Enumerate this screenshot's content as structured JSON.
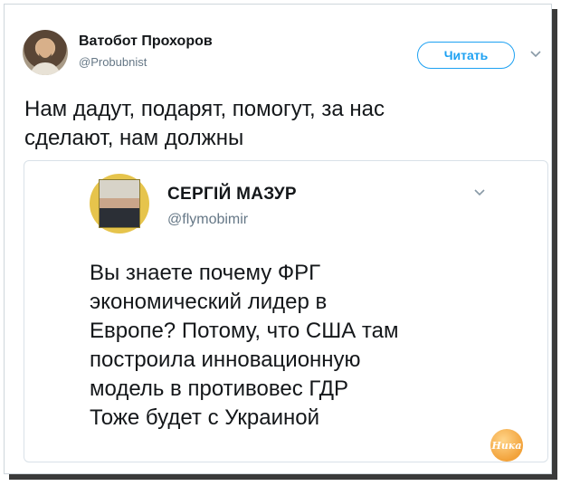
{
  "author": {
    "name": "Ватобот Прохоров",
    "handle": "@Probubnist"
  },
  "follow_button": {
    "label": "Читать"
  },
  "tweet": {
    "text_lines": [
      "Нам дадут, подарят, помогут, за нас",
      "сделают, нам должны"
    ]
  },
  "quoted_tweet": {
    "author_name": "СЕРГІЙ МАЗУР",
    "handle": "@flymobimir",
    "text_lines": [
      "Вы знаете почему ФРГ",
      "экономический лидер в",
      "Европе? Потому, что США там",
      "построила инновационную",
      "модель в противовес ГДР",
      "Тоже будет с Украиной"
    ]
  },
  "watermark": {
    "text": "Ника"
  },
  "colors": {
    "accent": "#1da1f2",
    "text": "#14171a",
    "secondary": "#657786"
  }
}
